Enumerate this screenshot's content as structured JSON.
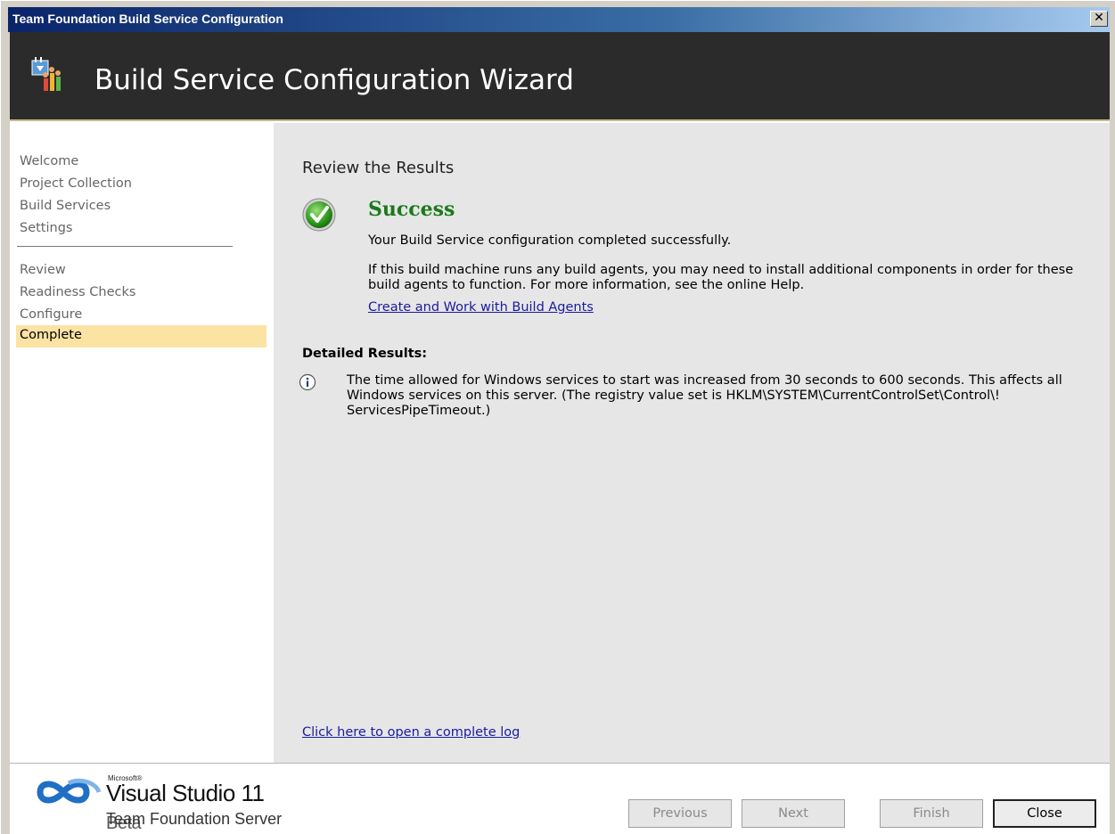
{
  "window": {
    "title": "Team Foundation Build Service Configuration",
    "close_glyph": "✕"
  },
  "banner": {
    "heading": "Build Service Configuration Wizard",
    "icon": "build-wizard-icon"
  },
  "sidebar": {
    "items": [
      {
        "label": "Welcome",
        "active": false
      },
      {
        "label": "Project Collection",
        "active": false
      },
      {
        "label": "Build Services",
        "active": false
      },
      {
        "label": "Settings",
        "active": false
      },
      {
        "label": "Review",
        "active": false
      },
      {
        "label": "Readiness Checks",
        "active": false
      },
      {
        "label": "Configure",
        "active": false
      },
      {
        "label": "Complete",
        "active": true
      }
    ]
  },
  "main": {
    "section_title": "Review the Results",
    "status": "Success",
    "status_message": "Your Build Service configuration completed successfully.",
    "info_message": "If this build machine runs any build agents, you may need to install additional components in order for these build agents to function. For more information, see the online Help.",
    "help_link": "Create and Work with Build Agents",
    "detailed_label": "Detailed Results:",
    "detail_message": "The time allowed for Windows services to start was increased from 30 seconds to 600 seconds. This affects all Windows services on this server. (The registry value set is HKLM\\SYSTEM\\CurrentControlSet\\Control\\! ServicesPipeTimeout.)",
    "log_link": "Click here to open a complete log"
  },
  "footer": {
    "logo_company": "Microsoft®",
    "logo_product": "Visual Studio",
    "logo_version": "11",
    "logo_edition": "Beta",
    "logo_subtitle": "Team Foundation Server",
    "buttons": {
      "previous": "Previous",
      "next": "Next",
      "finish": "Finish",
      "close": "Close"
    }
  },
  "colors": {
    "banner_bg": "#2b2b2b",
    "active_nav": "#fbe3a4",
    "success_green": "#1a7a1a",
    "link_blue": "#1a1aa0"
  }
}
